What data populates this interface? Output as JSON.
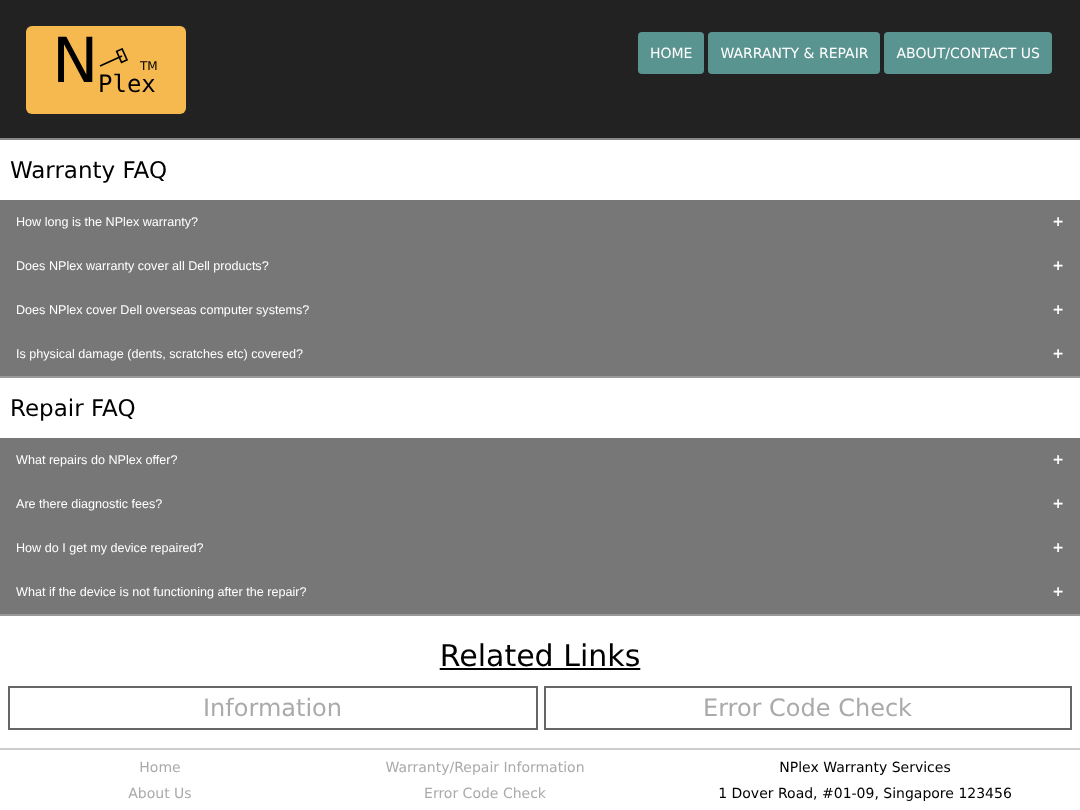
{
  "logo": {
    "letter": "N",
    "word": "Plex",
    "mark": "TM"
  },
  "nav": [
    {
      "label": "HOME"
    },
    {
      "label": "WARRANTY & REPAIR"
    },
    {
      "label": "ABOUT/CONTACT US"
    }
  ],
  "sections": [
    {
      "title": "Warranty FAQ",
      "questions": [
        {
          "text": "How long is the NPlex warranty?",
          "toggle": "+"
        },
        {
          "text": "Does NPlex warranty cover all Dell products?",
          "toggle": "+"
        },
        {
          "text": "Does NPlex cover Dell overseas computer systems?",
          "toggle": "+"
        },
        {
          "text": "Is physical damage (dents, scratches etc) covered?",
          "toggle": "+"
        }
      ]
    },
    {
      "title": "Repair FAQ",
      "questions": [
        {
          "text": "What repairs do NPlex offer?",
          "toggle": "+"
        },
        {
          "text": "Are there diagnostic fees?",
          "toggle": "+"
        },
        {
          "text": "How do I get my device repaired?",
          "toggle": "+"
        },
        {
          "text": "What if the device is not functioning after the repair?",
          "toggle": "+"
        }
      ]
    }
  ],
  "related": {
    "title": "Related Links",
    "links": [
      "Information",
      "Error Code Check"
    ]
  },
  "footer": {
    "column_1": [
      "Home",
      "About Us"
    ],
    "column_2": [
      "Warranty/Repair Information",
      "Error Code Check"
    ],
    "company": "NPlex Warranty Services",
    "address": "1 Dover Road, #01-09, Singapore 123456"
  }
}
